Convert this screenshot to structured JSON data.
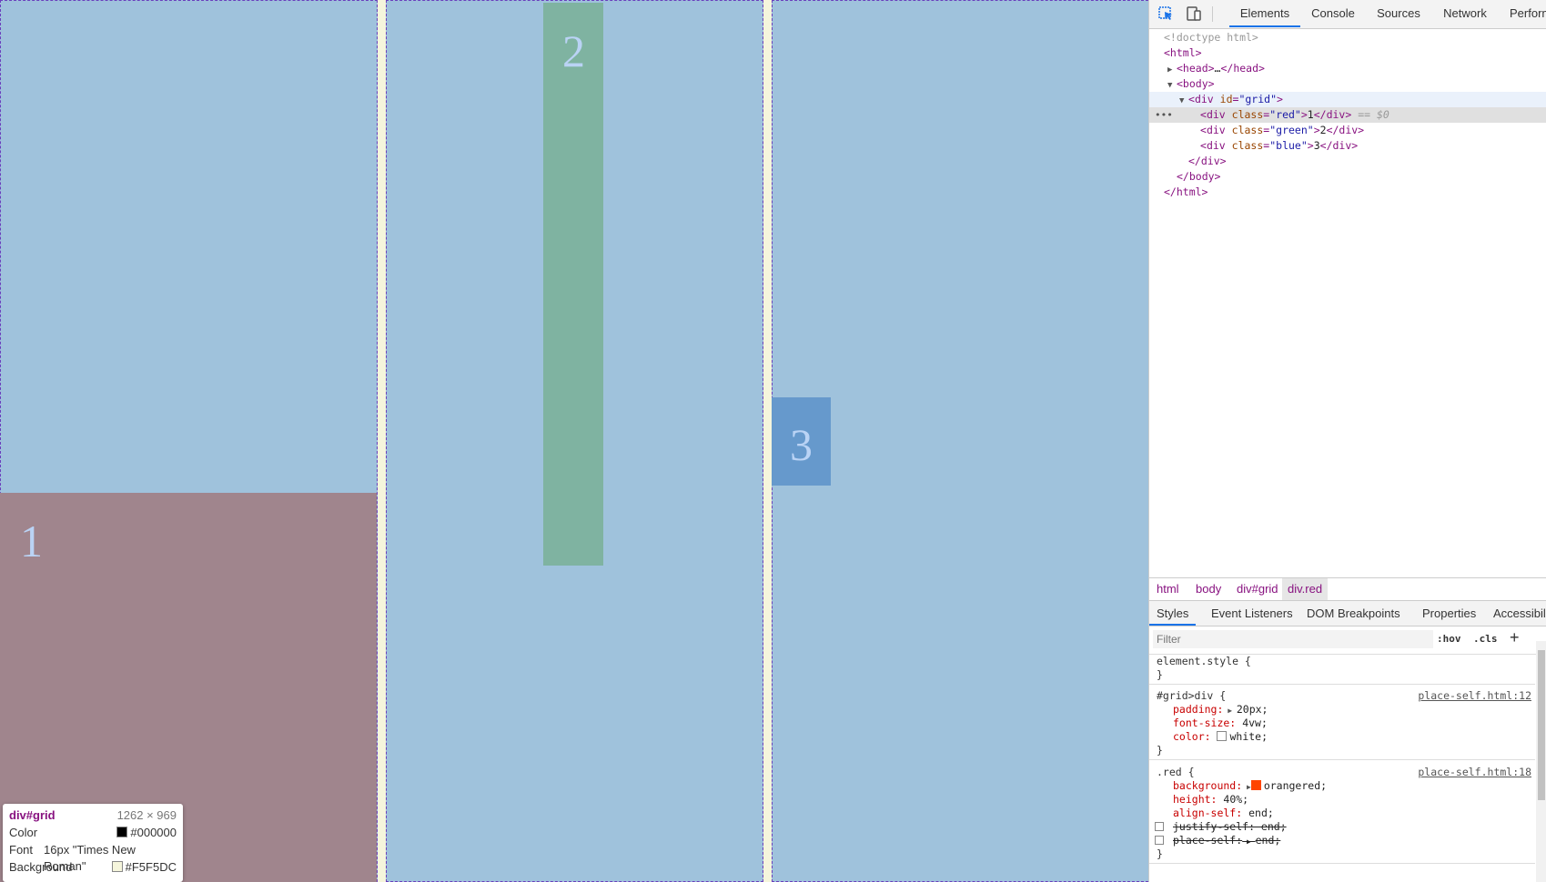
{
  "grid": {
    "cells": [
      {
        "label": "1",
        "class": "red"
      },
      {
        "label": "2",
        "class": "green"
      },
      {
        "label": "3",
        "class": "blue"
      }
    ]
  },
  "tooltip": {
    "title": "div#grid",
    "size": "1262 × 969",
    "color_label": "Color",
    "color_value": "#000000",
    "font_label": "Font",
    "font_value": "16px \"Times New Roman\"",
    "background_label": "Background",
    "background_value": "#F5F5DC"
  },
  "devtools": {
    "tabs": [
      "Elements",
      "Console",
      "Sources",
      "Network",
      "Performa"
    ],
    "dom": {
      "doctype": "<!doctype html>",
      "html_open": "<html>",
      "head_open": "<head>",
      "head_ellipsis": "…",
      "head_close": "</head>",
      "body_open": "<body>",
      "grid_tag": "div",
      "grid_attr": "id",
      "grid_value": "\"grid\"",
      "div_tag": "div",
      "class_attr": "class",
      "red_value": "\"red\"",
      "red_text": "1",
      "selected_marker": "== $0",
      "green_value": "\"green\"",
      "green_text": "2",
      "blue_value": "\"blue\"",
      "blue_text": "3",
      "div_close": "</div>",
      "body_close": "</body>",
      "html_close": "</html>"
    },
    "breadcrumb": [
      "html",
      "body",
      "div#grid",
      "div.red"
    ],
    "sub_tabs": [
      "Styles",
      "Event Listeners",
      "DOM Breakpoints",
      "Properties",
      "Accessibili"
    ],
    "filter_placeholder": "Filter",
    "hov": ":hov",
    "cls": ".cls",
    "add_rule": "+",
    "rules": {
      "element_style": "element.style {",
      "close_brace": "}",
      "grid_selector": "#grid>div {",
      "grid_source": "place-self.html:12",
      "padding_prop": "padding:",
      "padding_val": "20px;",
      "fontsize_prop": "font-size:",
      "fontsize_val": "4vw;",
      "color_prop": "color:",
      "color_val": "white;",
      "red_selector": ".red {",
      "red_source": "place-self.html:18",
      "bg_prop": "background:",
      "bg_val": "orangered;",
      "height_prop": "height:",
      "height_val": "40%;",
      "alignself_prop": "align-self:",
      "alignself_val": "end;",
      "justifyself_text": "justify-self: end;",
      "placeself_text": "place-self:",
      "placeself_val": "end;"
    },
    "colors": {
      "swatch_orangered": "#ff4500",
      "swatch_white": "#ffffff",
      "accent": "#1a73e8"
    }
  }
}
